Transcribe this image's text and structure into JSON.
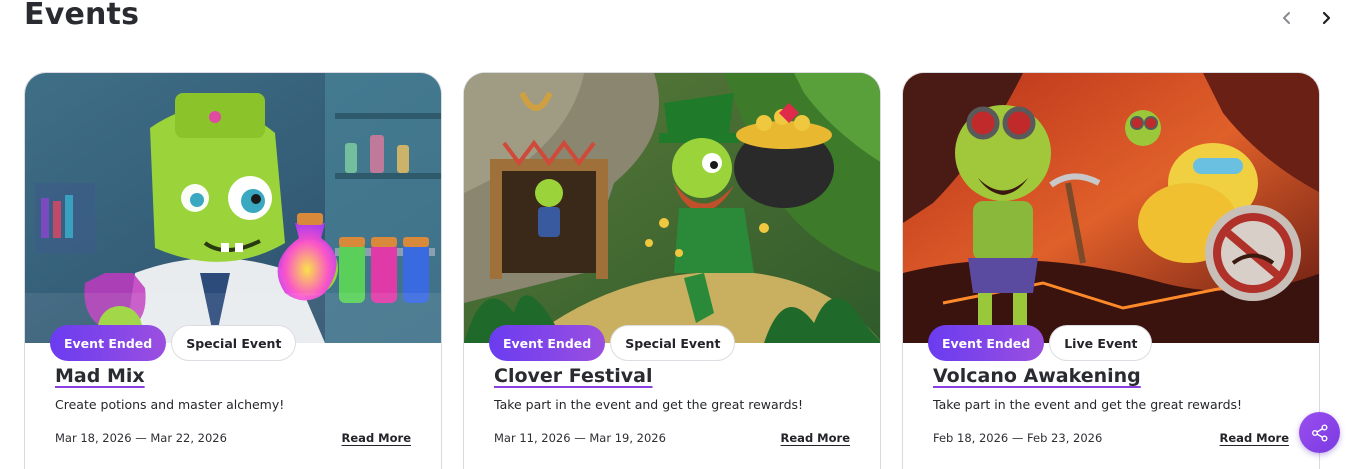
{
  "header": {
    "title": "Events",
    "prev_icon": "chevron-left-icon",
    "next_icon": "chevron-right-icon"
  },
  "cards": [
    {
      "status_badge": "Event Ended",
      "type_badge": "Special Event",
      "title": "Mad Mix",
      "description": "Create potions and master alchemy!",
      "dates": "Mar 18, 2026 — Mar 22, 2026",
      "read_more": "Read More"
    },
    {
      "status_badge": "Event Ended",
      "type_badge": "Special Event",
      "title": "Clover Festival",
      "description": "Take part in the event and get the great rewards!",
      "dates": "Mar 11, 2026 — Mar 19, 2026",
      "read_more": "Read More"
    },
    {
      "status_badge": "Event Ended",
      "type_badge": "Live Event",
      "title": "Volcano Awakening",
      "description": "Take part in the event and get the great rewards!",
      "dates": "Feb 18, 2026 — Feb 23, 2026",
      "read_more": "Read More"
    }
  ],
  "share_button": {
    "icon": "share-icon"
  },
  "colors": {
    "badge_gradient_start": "#6a3cf0",
    "badge_gradient_end": "#9b4fe0",
    "title_underline": "#8a3fe0",
    "share_button": "#8b45e8"
  }
}
